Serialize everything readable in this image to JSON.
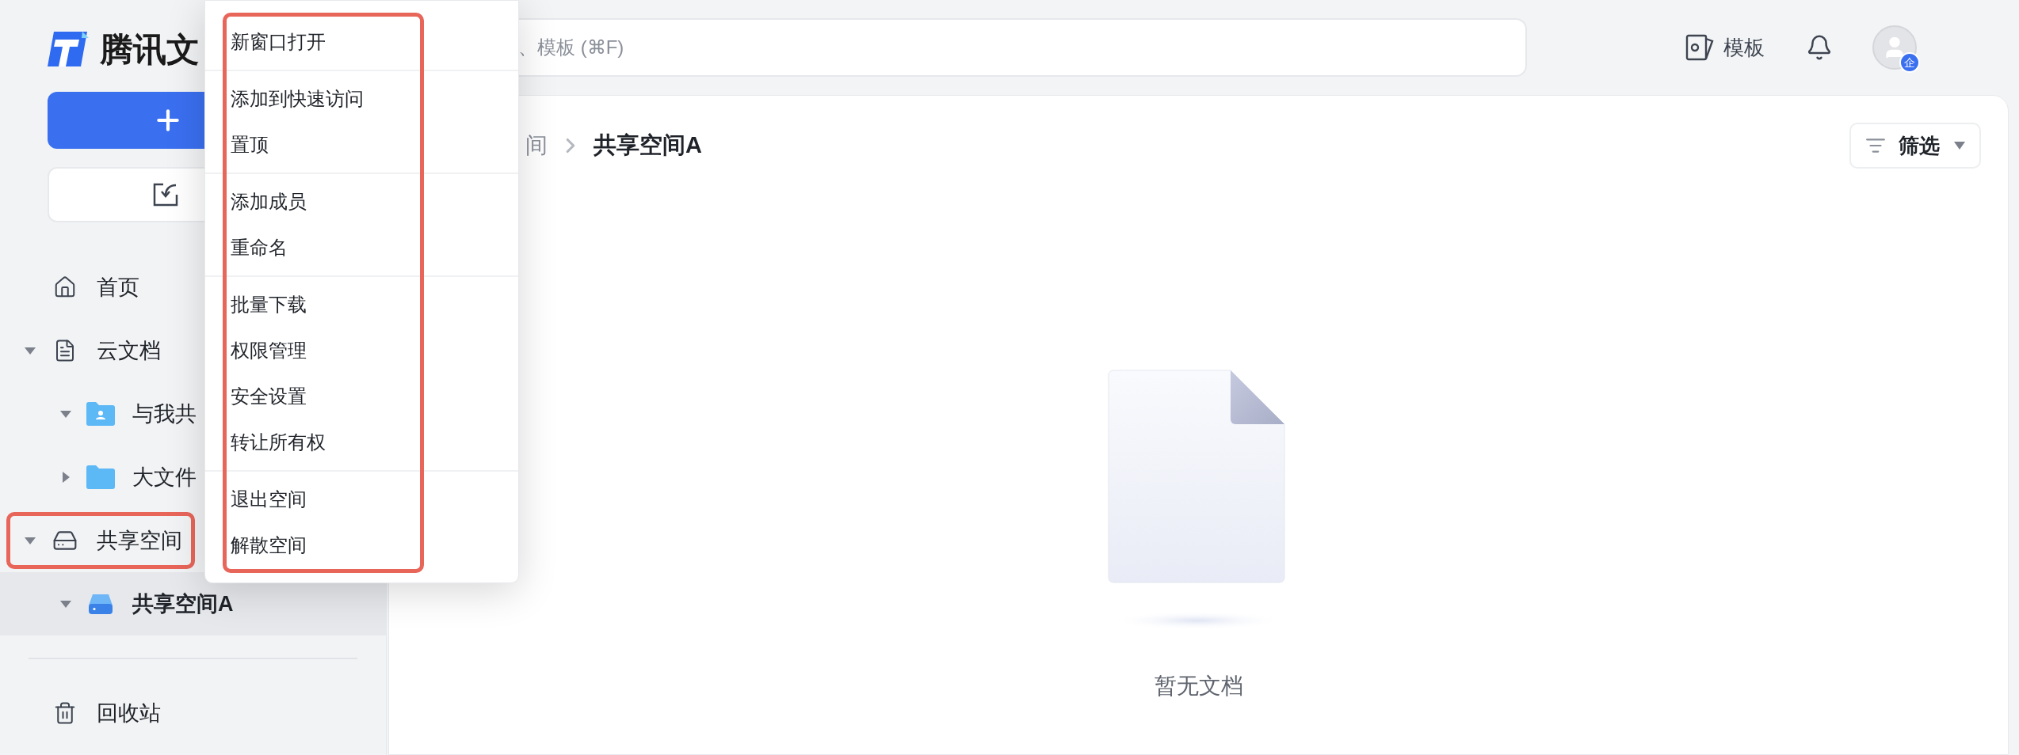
{
  "sidebar": {
    "logo_text": "腾讯文",
    "nav": [
      {
        "label": "首页",
        "kind": "home",
        "selected": false
      },
      {
        "label": "云文档",
        "kind": "doc",
        "expanded": true,
        "selected": false,
        "children": [
          {
            "label": "与我共",
            "kind": "shared-folder",
            "expanded": true,
            "selected": false
          },
          {
            "label": "大文件",
            "kind": "folder",
            "expanded": false,
            "selected": false
          }
        ]
      },
      {
        "label": "共享空间",
        "kind": "drive",
        "expanded": true,
        "selected": false,
        "annotated": true,
        "children": [
          {
            "label": "共享空间A",
            "kind": "drive-blue",
            "expanded": true,
            "selected": true
          }
        ]
      }
    ],
    "footer_items": [
      {
        "label": "回收站",
        "kind": "trash",
        "selected": false
      }
    ]
  },
  "top_bar": {
    "search": {
      "placeholder": "、模板 (⌘F)"
    },
    "templates_label": "模板",
    "avatar_badge": "企"
  },
  "breadcrumb": [
    "间",
    "共享空间A"
  ],
  "filter_button": {
    "label": "筛选"
  },
  "empty_state": {
    "message": "暂无文档"
  },
  "context_menu": {
    "annotated": true,
    "groups": [
      [
        "新窗口打开"
      ],
      [
        "添加到快速访问",
        "置顶"
      ],
      [
        "添加成员",
        "重命名"
      ],
      [
        "批量下载",
        "权限管理",
        "安全设置",
        "转让所有权"
      ],
      [
        "退出空间",
        "解散空间"
      ]
    ]
  }
}
